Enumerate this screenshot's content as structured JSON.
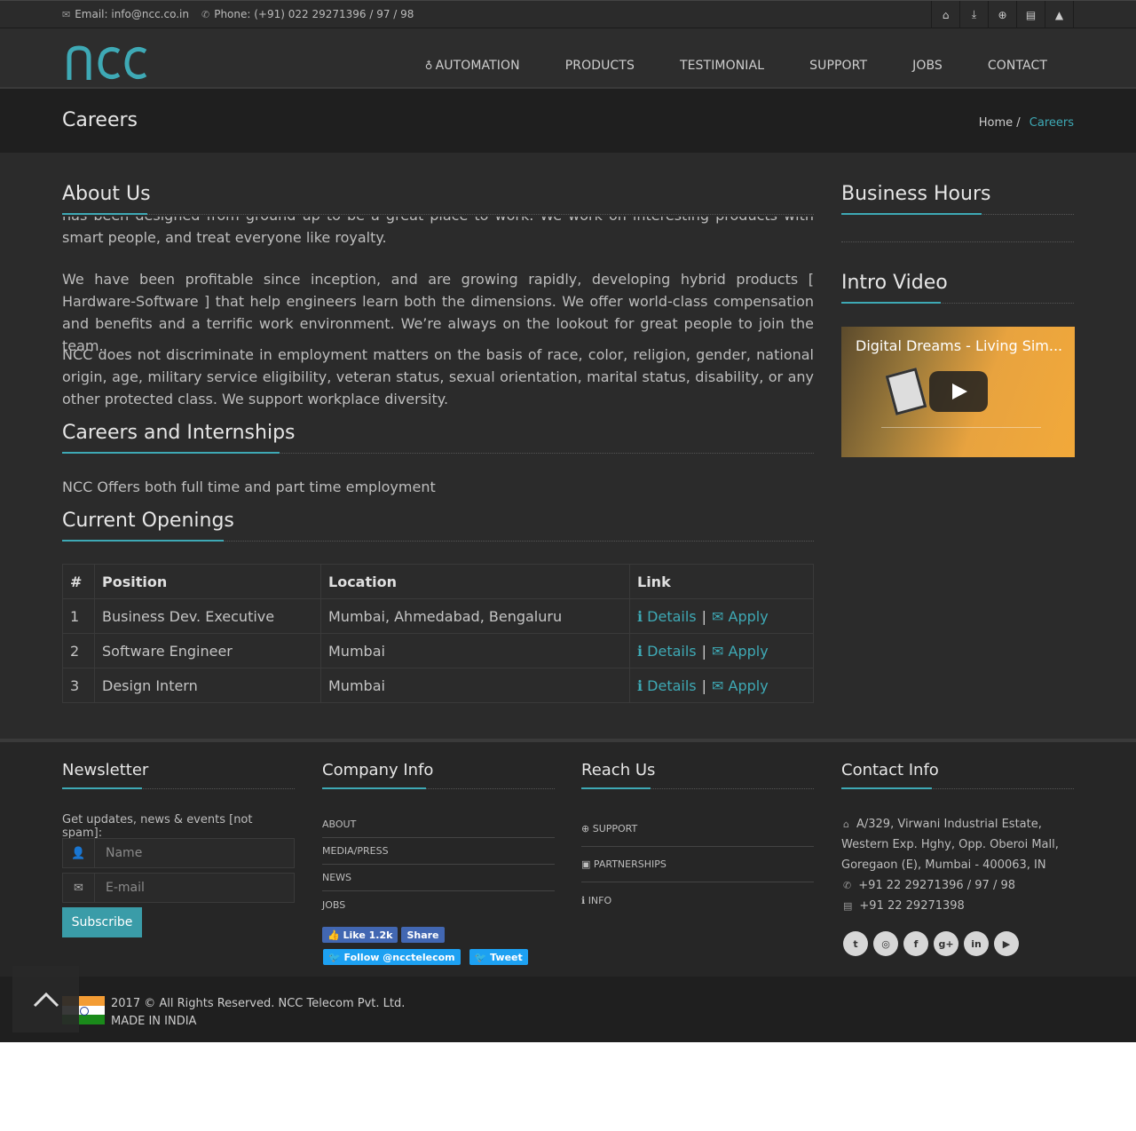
{
  "topbar": {
    "email": "Email: info@ncc.co.in",
    "phone": "Phone: (+91) 022 29271396 / 97 / 98",
    "icons": [
      "home-icon",
      "download-icon",
      "support-icon",
      "news-icon",
      "graduation-icon"
    ]
  },
  "header": {
    "logo_text": "ncc",
    "nav": [
      "AUTOMATION",
      "PRODUCTS",
      "TESTIMONIAL",
      "SUPPORT",
      "JOBS",
      "CONTACT"
    ]
  },
  "titlebar": {
    "title": "Careers",
    "breadcrumb_home": "Home",
    "breadcrumb_sep": "/",
    "breadcrumb_current": "Careers"
  },
  "about": {
    "title": "About Us",
    "p1": "has been designed from ground up to be a great place to work. We work on interesting products with smart people, and treat everyone like royalty.",
    "p2": "We have been profitable since inception, and are growing rapidly, developing hybrid products [ Hardware-Software ] that help engineers learn both the dimensions. We offer world-class compensation and benefits and a terrific work environment. We’re always on the lookout for great people to join the team.",
    "p3": "NCC does not discriminate in employment matters on the basis of race, color, religion, gender, national origin, age, military service eligibility, veteran status, sexual orientation, marital status, disability, or any other protected class. We support workplace diversity."
  },
  "careers": {
    "title": "Careers and Internships",
    "text": "NCC Offers both full time and part time employment"
  },
  "openings": {
    "title": "Current Openings",
    "headers": [
      "#",
      "Position",
      "Location",
      "Link"
    ],
    "details_label": "Details",
    "sep": "|",
    "apply_label": "Apply",
    "rows": [
      {
        "num": "1",
        "position": "Business Dev. Executive",
        "location": "Mumbai, Ahmedabad, Bengaluru"
      },
      {
        "num": "2",
        "position": "Software Engineer",
        "location": "Mumbai"
      },
      {
        "num": "3",
        "position": "Design Intern",
        "location": "Mumbai"
      }
    ]
  },
  "sidebar": {
    "hours_title": "Business Hours",
    "video_title": "Intro Video",
    "video_caption": "Digital Dreams - Living Sim..."
  },
  "footer": {
    "newsletter": {
      "title": "Newsletter",
      "text": "Get updates, news & events [not spam]:",
      "name_placeholder": "Name",
      "email_placeholder": "E-mail",
      "subscribe": "Subscribe"
    },
    "company": {
      "title": "Company Info",
      "links": [
        "ABOUT",
        "MEDIA/PRESS",
        "NEWS",
        "JOBS"
      ],
      "like": "Like 1.2k",
      "share": "Share",
      "follow": "Follow @ncctelecom",
      "tweet": "Tweet"
    },
    "reach": {
      "title": "Reach Us",
      "links": [
        "SUPPORT",
        "PARTNERSHIPS",
        "INFO"
      ]
    },
    "contact": {
      "title": "Contact Info",
      "address": "A/329, Virwani Industrial Estate, Western Exp. Hghy, Opp. Oberoi Mall, Goregaon (E), Mumbai - 400063, IN",
      "phone": "+91 22 29271396 / 97 / 98",
      "fax": "+91 22 29271398",
      "social": [
        "twitter-icon",
        "instagram-icon",
        "facebook-icon",
        "google-plus-icon",
        "linkedin-icon",
        "youtube-icon"
      ]
    },
    "copyright": "2017 © All Rights Reserved. NCC Telecom Pvt. Ltd.",
    "made_in": "MADE IN INDIA"
  },
  "colors": {
    "accent": "#3ea9b5",
    "background": "#2b2b2b",
    "dark": "#1f1f1f"
  }
}
